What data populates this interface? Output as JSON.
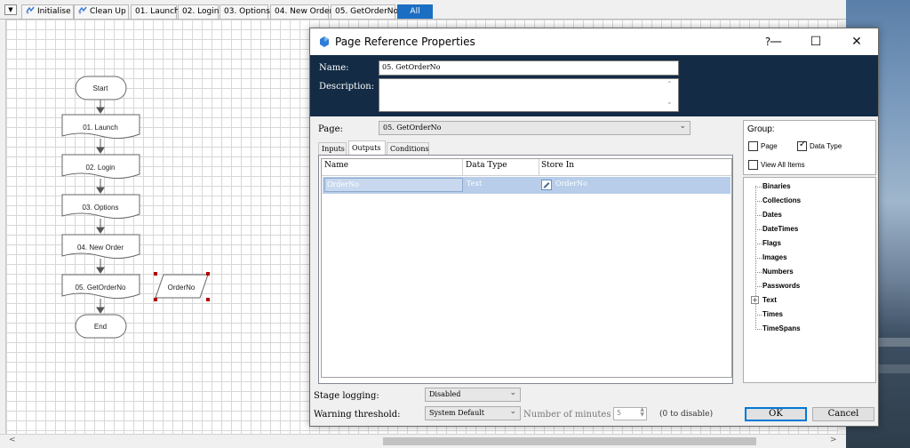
{
  "tabs": [
    {
      "label": "Initialise",
      "icon": "process-icon"
    },
    {
      "label": "Clean Up",
      "icon": "process-icon"
    },
    {
      "label": "01. Launch"
    },
    {
      "label": "02. Login"
    },
    {
      "label": "03. Options"
    },
    {
      "label": "04. New Order"
    },
    {
      "label": "05. GetOrderNo"
    },
    {
      "label": "All",
      "active": true
    }
  ],
  "flow": {
    "start": "Start",
    "steps": [
      "01. Launch",
      "02. Login",
      "03. Options",
      "04. New Order",
      "05. GetOrderNo"
    ],
    "end": "End",
    "data_item": "OrderNo"
  },
  "dialog": {
    "title": "Page Reference Properties",
    "help": "?",
    "name_label": "Name:",
    "name_value": "05. GetOrderNo",
    "description_label": "Description:",
    "description_value": "",
    "page_label": "Page:",
    "page_value": "05. GetOrderNo",
    "tabs": [
      "Inputs",
      "Outputs",
      "Conditions"
    ],
    "active_tab": "Outputs",
    "columns": [
      "Name",
      "Data Type",
      "Store In"
    ],
    "rows": [
      {
        "name": "OrderNo",
        "data_type": "Text",
        "store_in": "OrderNo"
      }
    ],
    "group_label": "Group:",
    "group_page": {
      "label": "Page",
      "checked": false
    },
    "group_datatype": {
      "label": "Data Type",
      "checked": true
    },
    "view_all": {
      "label": "View All Items",
      "checked": false
    },
    "tree_items": [
      "Binaries",
      "Collections",
      "Dates",
      "DateTimes",
      "Flags",
      "Images",
      "Numbers",
      "Passwords",
      "Text",
      "Times",
      "TimeSpans"
    ],
    "stage_logging_label": "Stage logging:",
    "stage_logging_value": "Disabled",
    "warning_label": "Warning threshold:",
    "warning_value": "System Default",
    "minutes_label": "Number of minutes",
    "minutes_value": "5",
    "disable_hint": "(0 to disable)",
    "ok_label": "OK",
    "cancel_label": "Cancel"
  },
  "colors": {
    "header_bg": "#132b45",
    "active_tab": "#1b6ec2",
    "selection": "#b7cde9",
    "default_button_border": "#0078d7"
  }
}
